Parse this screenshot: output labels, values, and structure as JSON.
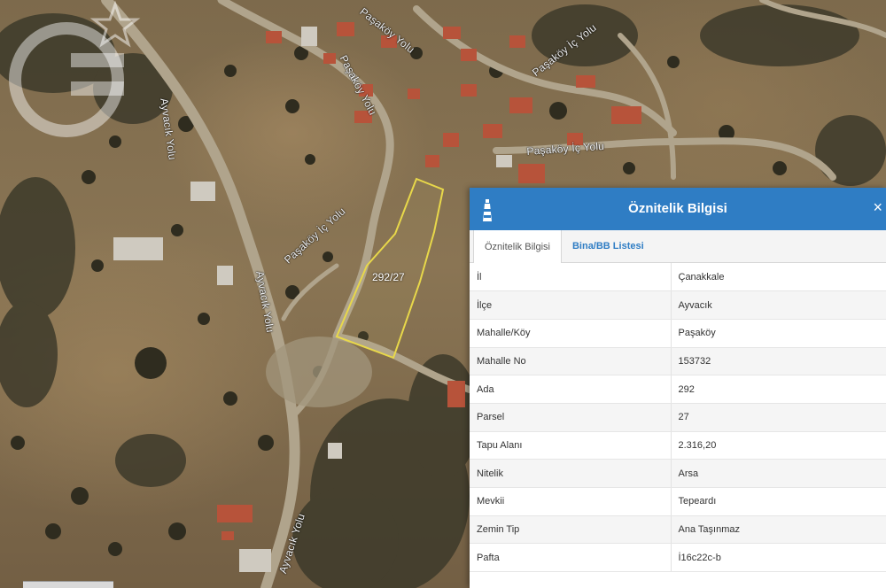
{
  "map": {
    "road_labels": {
      "ayvacik_yolu_top": "Ayvacık Yolu",
      "ayvacik_yolu_mid": "Ayvacık Yolu",
      "ayvacik_yolu_bottom": "Ayvacık Yolu",
      "pasakoy_top": "Paşaköy Yolu",
      "pasakoy_mid": "Paşaköy Yolu",
      "pasakoy_left": "Paşaköy İç Yolu",
      "pasakoy_ic_yolu": "Paşaköy İç Yolu",
      "pasakoy_right": "Paşaköy İç Yolu"
    },
    "parcel_label": "292/27",
    "parcel_outline_color": "#e8d84a"
  },
  "panel": {
    "title": "Öznitelik Bilgisi",
    "close_label": "×",
    "header_color": "#2f7dc4",
    "tabs": [
      {
        "label": "Öznitelik Bilgisi",
        "active": true
      },
      {
        "label": "Bina/BB Listesi",
        "active": false
      }
    ],
    "rows": [
      {
        "key": "İl",
        "value": "Çanakkale"
      },
      {
        "key": "İlçe",
        "value": "Ayvacık"
      },
      {
        "key": "Mahalle/Köy",
        "value": "Paşaköy"
      },
      {
        "key": "Mahalle No",
        "value": "153732"
      },
      {
        "key": "Ada",
        "value": "292"
      },
      {
        "key": "Parsel",
        "value": "27"
      },
      {
        "key": "Tapu Alanı",
        "value": "2.316,20"
      },
      {
        "key": "Nitelik",
        "value": "Arsa"
      },
      {
        "key": "Mevkii",
        "value": "Tepeardı"
      },
      {
        "key": "Zemin Tip",
        "value": "Ana Taşınmaz"
      },
      {
        "key": "Pafta",
        "value": "İ16c22c-b"
      }
    ]
  }
}
